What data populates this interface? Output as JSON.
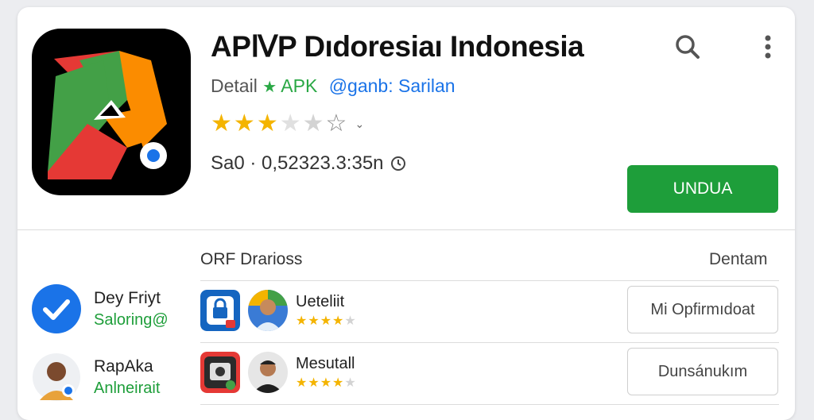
{
  "app": {
    "title": "APⅣP Dıdoresiaı Indonesia",
    "detail_prefix": "Detail",
    "detail_badge": "APK",
    "developer": "@ganb: Sarilan",
    "rating_stars": 3,
    "rating_total": 5,
    "meta": "Sa0 · 0,52323.3:35n",
    "install_label": "UNDUA"
  },
  "section": {
    "title": "ORF Drarioss",
    "link": "Dentam"
  },
  "side_users": [
    {
      "name": "Dey Friyt",
      "sub": "Saloring@"
    },
    {
      "name": "RapAka",
      "sub": "Anlneirait"
    }
  ],
  "rows": [
    {
      "name": "Ueteliit",
      "stars": 4,
      "button": "Mi Opfirmıdoat"
    },
    {
      "name": "Mesutall",
      "stars": 4,
      "button": "Dunsánukım"
    }
  ],
  "colors": {
    "accent_green": "#1e9e3a",
    "link_blue": "#1a73e8",
    "star_gold": "#f4b400"
  },
  "icons": {
    "search": "search-icon",
    "more": "more-vert-icon",
    "clock": "clock-icon",
    "verified": "verified-check-icon"
  }
}
